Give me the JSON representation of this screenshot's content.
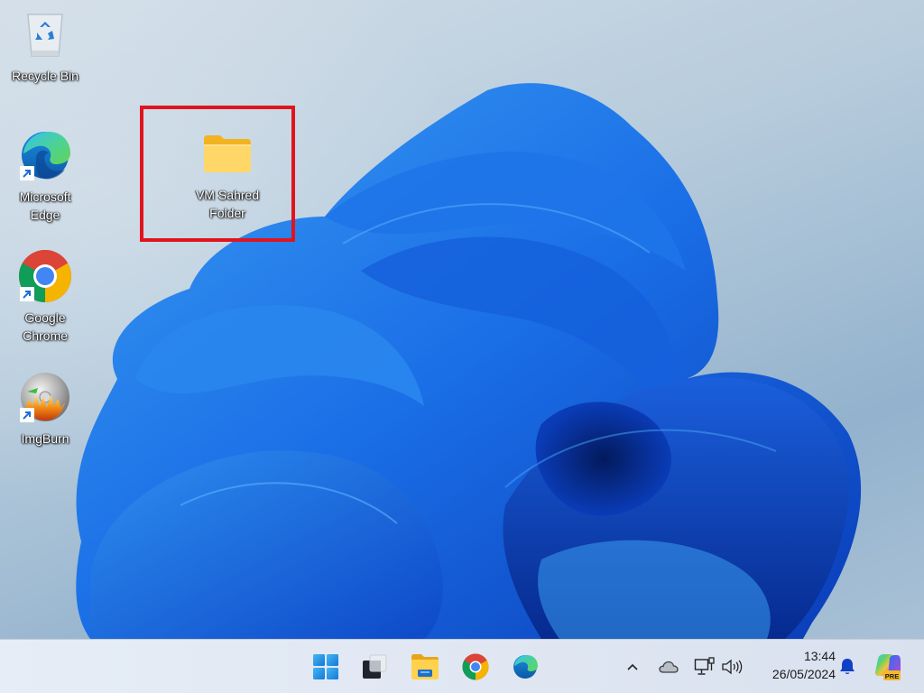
{
  "desktop": {
    "icons": [
      {
        "label": "Recycle Bin",
        "icon": "recycle-bin-icon",
        "shortcut": false
      },
      {
        "label": "Microsoft Edge",
        "icon": "edge-icon",
        "shortcut": true
      },
      {
        "label": "Google Chrome",
        "icon": "chrome-icon",
        "shortcut": true
      },
      {
        "label": "ImgBurn",
        "icon": "imgburn-icon",
        "shortcut": true
      },
      {
        "label": "VM Sahred Folder",
        "icon": "folder-icon",
        "shortcut": false
      }
    ],
    "highlight_color": "#e0141e"
  },
  "taskbar": {
    "pinned": [
      {
        "name": "Start",
        "icon": "windows-start-icon"
      },
      {
        "name": "Task View",
        "icon": "task-view-icon"
      },
      {
        "name": "File Explorer",
        "icon": "file-explorer-icon"
      },
      {
        "name": "Google Chrome",
        "icon": "chrome-icon"
      },
      {
        "name": "Microsoft Edge",
        "icon": "edge-icon"
      }
    ],
    "tray": {
      "overflow": "chevron-up-icon",
      "onedrive": "cloud-icon",
      "network": "network-wired-icon",
      "volume": "speaker-icon",
      "time": "13:44",
      "date": "26/05/2024",
      "notifications": "bell-icon",
      "copilot_badge": "PRE"
    }
  }
}
